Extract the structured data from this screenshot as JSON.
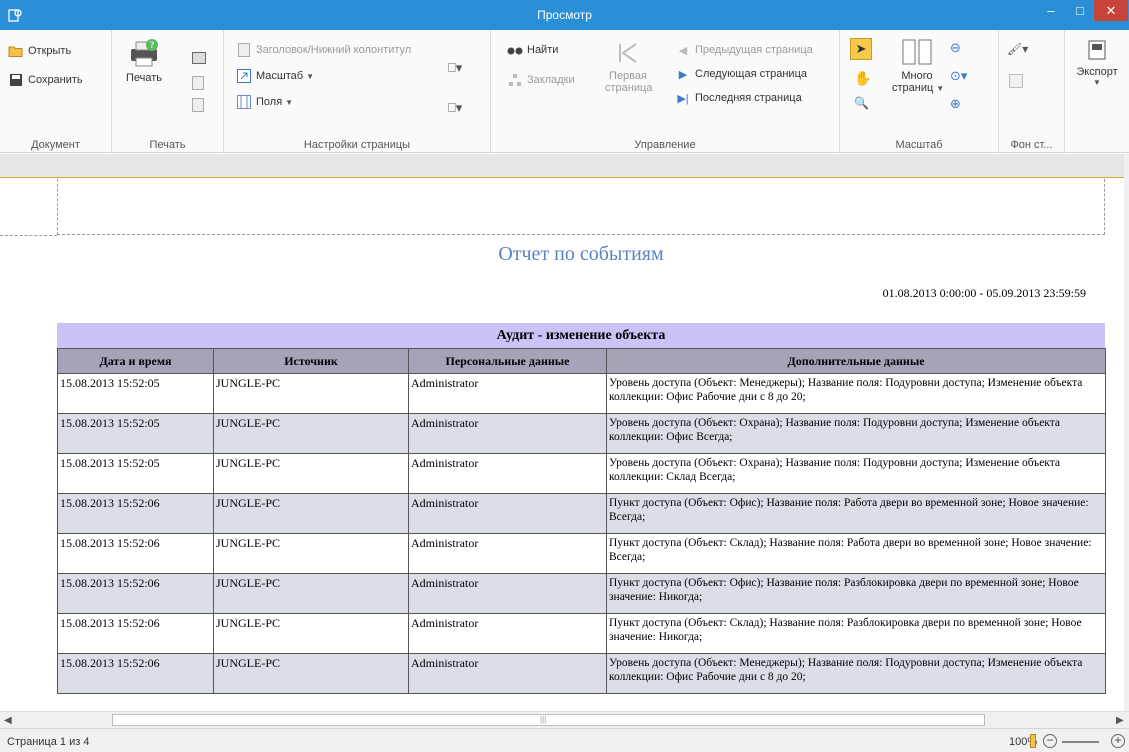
{
  "window": {
    "title": "Просмотр",
    "minimize": "–",
    "maximize": "□",
    "close": "✕"
  },
  "ribbon": {
    "document": {
      "label": "Документ",
      "open": "Открыть",
      "save": "Сохранить"
    },
    "print": {
      "label": "Печать",
      "print_button": "Печать"
    },
    "page_setup": {
      "label": "Настройки страницы",
      "header_footer": "Заголовок/Нижний колонтитул",
      "scale": "Масштаб",
      "fields": "Поля"
    },
    "navigation": {
      "label": "Управление",
      "find": "Найти",
      "bookmarks": "Закладки",
      "first_page_line1": "Первая",
      "first_page_line2": "страница",
      "prev_page": "Предыдущая страница",
      "next_page": "Следующая страница",
      "last_page": "Последняя страница"
    },
    "zoom": {
      "label": "Масштаб",
      "many_pages_line1": "Много",
      "many_pages_line2": "страниц"
    },
    "background": {
      "label": "Фон ст..."
    },
    "export": {
      "label": "Экспорт"
    }
  },
  "report": {
    "title": "Отчет по событиям",
    "date_range": "01.08.2013 0:00:00 - 05.09.2013 23:59:59",
    "section_title": "Аудит - изменение объекта",
    "columns": [
      "Дата и время",
      "Источник",
      "Персональные данные",
      "Дополнительные данные"
    ],
    "rows": [
      [
        "15.08.2013 15:52:05",
        "JUNGLE-PC",
        "Administrator",
        "Уровень доступа (Объект: Менеджеры); Название поля: Подуровни доступа; Изменение объекта коллекции: Офис Рабочие дни с 8 до 20;"
      ],
      [
        "15.08.2013 15:52:05",
        "JUNGLE-PC",
        "Administrator",
        "Уровень доступа (Объект: Охрана); Название поля: Подуровни доступа; Изменение объекта коллекции: Офис Всегда;"
      ],
      [
        "15.08.2013 15:52:05",
        "JUNGLE-PC",
        "Administrator",
        "Уровень доступа (Объект: Охрана); Название поля: Подуровни доступа; Изменение объекта коллекции: Склад Всегда;"
      ],
      [
        "15.08.2013 15:52:06",
        "JUNGLE-PC",
        "Administrator",
        "Пункт доступа (Объект: Офис); Название поля: Работа двери во временной зоне; Новое значение: Всегда;"
      ],
      [
        "15.08.2013 15:52:06",
        "JUNGLE-PC",
        "Administrator",
        "Пункт доступа (Объект: Склад); Название поля: Работа двери во временной зоне; Новое значение: Всегда;"
      ],
      [
        "15.08.2013 15:52:06",
        "JUNGLE-PC",
        "Administrator",
        "Пункт доступа (Объект: Офис); Название поля: Разблокировка двери по временной зоне; Новое значение: Никогда;"
      ],
      [
        "15.08.2013 15:52:06",
        "JUNGLE-PC",
        "Administrator",
        "Пункт доступа (Объект: Склад); Название поля: Разблокировка двери по временной зоне; Новое значение: Никогда;"
      ],
      [
        "15.08.2013 15:52:06",
        "JUNGLE-PC",
        "Administrator",
        "Уровень доступа (Объект: Менеджеры); Название поля: Подуровни доступа; Изменение объекта коллекции: Офис Рабочие дни с 8 до 20;"
      ]
    ]
  },
  "status": {
    "page_info": "Страница 1 из 4",
    "zoom": "100%"
  },
  "colors": {
    "titlebar": "#2a8fd6",
    "close": "#c7443a",
    "section": "#c9c4f5",
    "header": "#a6a3b9",
    "alt_row": "#dcdee6",
    "title_text": "#5a83c4"
  }
}
